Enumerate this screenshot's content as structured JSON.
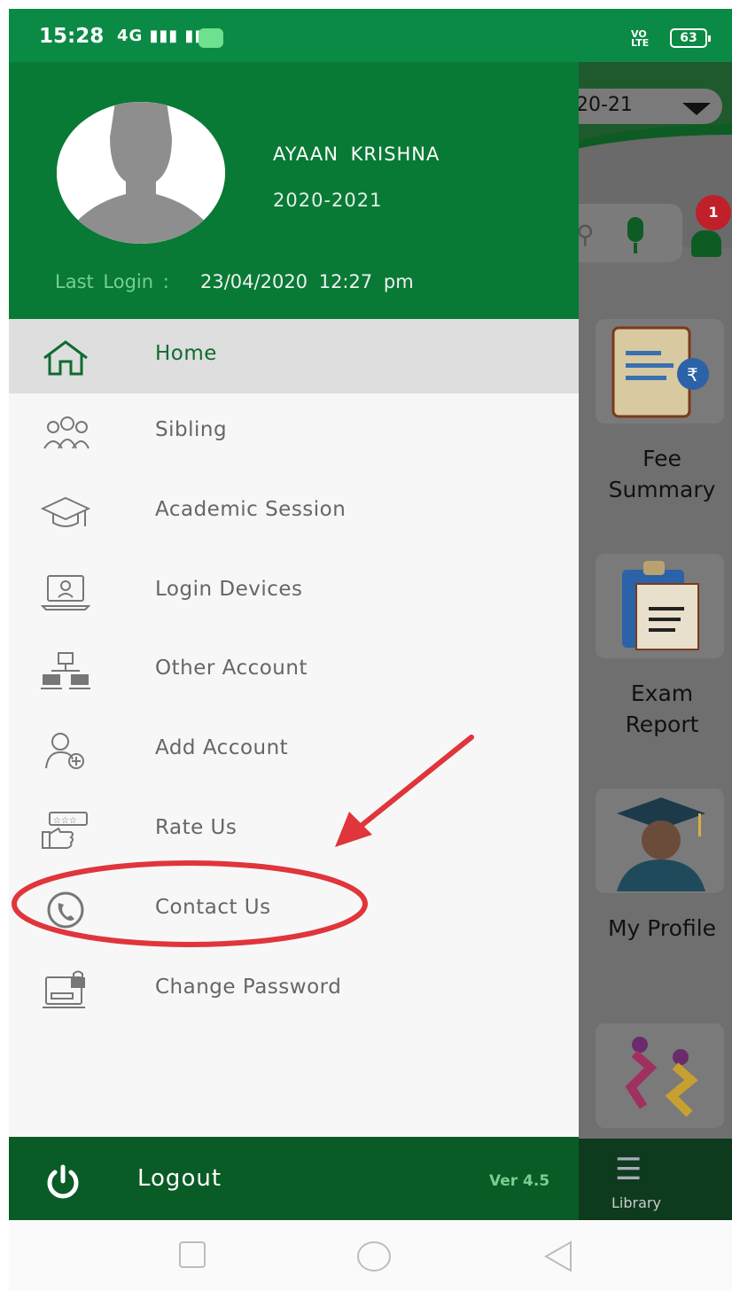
{
  "status_bar": {
    "time": "15:28",
    "signal": "4G",
    "volte": "VO LTE",
    "battery": "63"
  },
  "background_app": {
    "session_selector": "20-21",
    "notification_count": "1",
    "tiles": [
      {
        "label_line1": "Fee",
        "label_line2": "Summary",
        "icon": "fee-document-icon"
      },
      {
        "label_line1": "Exam",
        "label_line2": "Report",
        "icon": "clipboard-report-icon"
      },
      {
        "label_line1": "My Profile",
        "label_line2": "",
        "icon": "graduate-avatar-icon"
      },
      {
        "label_line1": "",
        "label_line2": "",
        "icon": "sports-icon"
      }
    ],
    "bottom_tab": "Library"
  },
  "drawer": {
    "user_name": "AYAAN  KRISHNA",
    "session": "2020-2021",
    "last_login_label": "Last Login :",
    "last_login_value": "23/04/2020  12:27 pm",
    "menu": [
      {
        "label": "Home",
        "icon": "home-icon",
        "active": true
      },
      {
        "label": "Sibling",
        "icon": "family-icon"
      },
      {
        "label": "Academic Session",
        "icon": "graduation-cap-icon"
      },
      {
        "label": "Login Devices",
        "icon": "laptop-user-icon"
      },
      {
        "label": "Other Account",
        "icon": "network-computers-icon"
      },
      {
        "label": "Add Account",
        "icon": "add-user-icon"
      },
      {
        "label": "Rate Us",
        "icon": "thumbs-up-stars-icon"
      },
      {
        "label": "Contact Us",
        "icon": "phone-icon"
      },
      {
        "label": "Change Password",
        "icon": "lock-computer-icon"
      }
    ],
    "logout_label": "Logout",
    "version": "Ver 4.5"
  },
  "colors": {
    "brand_green": "#087a35",
    "footer_green": "#0a5c26",
    "accent_light_green": "#76d08f",
    "annotation_red": "#e0353b"
  }
}
